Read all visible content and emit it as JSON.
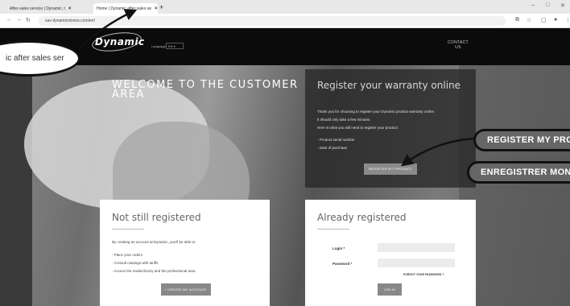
{
  "browser": {
    "tabs": [
      {
        "label": "After-sales service | Dynamic, t"
      },
      {
        "label": "Home | Dynamic after sales se"
      }
    ],
    "new_tab": "+",
    "url": "sav-dynamicmixers.com/en/",
    "window_controls": [
      "–",
      "□",
      "✕"
    ]
  },
  "header": {
    "logo": "Dynamic",
    "language_label": "Language:",
    "language_value": "EN",
    "contact_line1": "CONTACT",
    "contact_line2": "US"
  },
  "hero": {
    "welcome_line1": "WELCOME TO THE CUSTOMER",
    "welcome_line2": "AREA"
  },
  "warranty": {
    "title": "Register your warranty online",
    "lines": [
      "Thank you for choosing to register your Dynamic product warranty online.",
      "It should only take a few minutes.",
      "Here is what you will need to register your product:",
      "- Product serial number",
      "- Date of purchase"
    ],
    "button": "REGISTER MY PRODUCT"
  },
  "not_registered": {
    "title": "Not still registered",
    "intro": "By creating an account at Dynamic, you'll be able to:",
    "bullets": [
      "- Place your orders",
      "- Consult catalogs with tariffs",
      "- Access the media library and the professional area"
    ],
    "button": "I CREATE MY ACCOUNT"
  },
  "already_registered": {
    "title": "Already registered",
    "login_label": "Login *",
    "password_label": "Password *",
    "forgot": "FORGOT YOUR PASSWORD ?",
    "button": "LOG IN"
  },
  "annotations": {
    "bubble": "ic after sales ser",
    "callout_en": "REGISTER MY PRO",
    "callout_fr": "ENREGISTRER MON P"
  }
}
